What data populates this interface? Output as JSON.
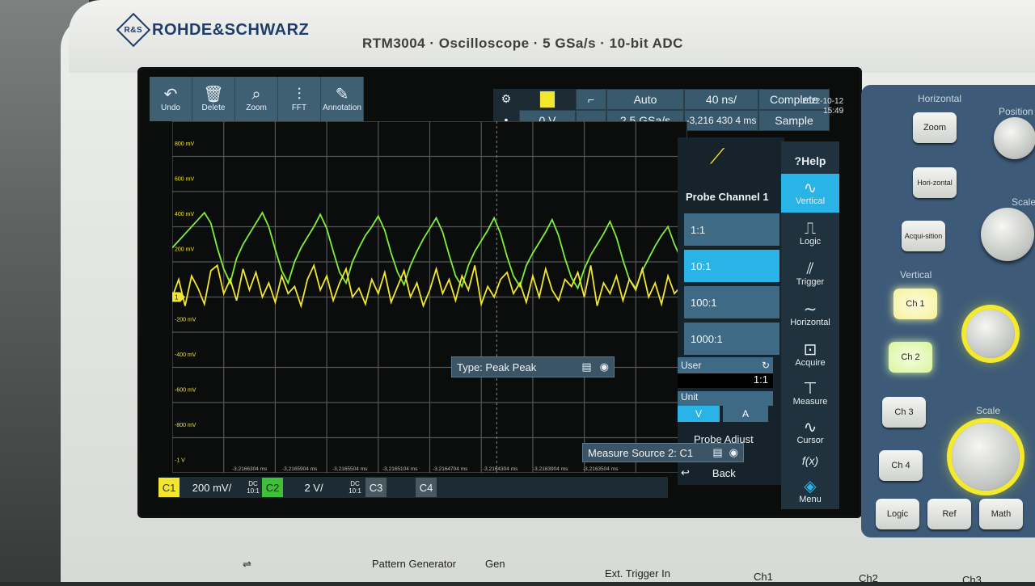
{
  "brand": {
    "name": "ROHDE&SCHWARZ",
    "model_line": "RTM3004 · Oscilloscope · 5 GSa/s · 10-bit ADC"
  },
  "toolbar": [
    {
      "label": "Undo",
      "icon": "undo-icon"
    },
    {
      "label": "Delete",
      "icon": "trash-icon"
    },
    {
      "label": "Zoom",
      "icon": "zoom-icon"
    },
    {
      "label": "FFT",
      "icon": "fft-icon"
    },
    {
      "label": "Annotation",
      "icon": "pencil-icon"
    }
  ],
  "status": {
    "trigger_level": "0 V",
    "trigger_mode": "Auto",
    "sample_rate": "2,5 GSa/s",
    "timebase": "40 ns/",
    "position": "-3,216 430 4 ms",
    "acq_state": "Complete",
    "acq_mode": "Sample",
    "date": "2022-10-12",
    "time": "15:49"
  },
  "y_labels": [
    "800 mV",
    "600 mV",
    "400 mV",
    "200 mV",
    "",
    "-200 mV",
    "-400 mV",
    "-600 mV",
    "-800 mV",
    "-1 V"
  ],
  "x_labels": [
    "-3,2166304 ms",
    "-3,2165904 ms",
    "-3,2165504 ms",
    "-3,2165104 ms",
    "-3,2164704 ms",
    "-3,2164304 ms",
    "-3,2163904 ms",
    "-3,2163504 ms"
  ],
  "marker_c1": "1",
  "probe_menu": {
    "title": "Probe Channel 1",
    "options": [
      "1:1",
      "10:1",
      "100:1",
      "1000:1"
    ],
    "selected_index": 1,
    "user_label": "User",
    "user_value": "1:1",
    "unit_label": "Unit",
    "unit_options": [
      "V",
      "A"
    ],
    "probe_adjust": "Probe Adjust",
    "back": "Back"
  },
  "right_bar": [
    {
      "label": "Help",
      "icon": "help-icon"
    },
    {
      "label": "Vertical",
      "icon": "vertical-icon"
    },
    {
      "label": "Logic",
      "icon": "logic-icon"
    },
    {
      "label": "Trigger",
      "icon": "trigger-icon"
    },
    {
      "label": "Horizontal",
      "icon": "horizontal-icon"
    },
    {
      "label": "Acquire",
      "icon": "acquire-icon"
    },
    {
      "label": "Measure",
      "icon": "measure-icon"
    },
    {
      "label": "Cursor",
      "icon": "cursor-icon"
    },
    {
      "label": "f(x)",
      "icon": "math-icon"
    },
    {
      "label": "Menu",
      "icon": "menu-icon"
    }
  ],
  "popups": {
    "type": "Type: Peak Peak",
    "measure_source": "Measure Source 2: C1"
  },
  "channel_bar": {
    "c1": "C1",
    "c1_scale": "200 mV/",
    "c1_coupling": "DC",
    "c1_probe": "10:1",
    "c2": "C2",
    "c2_scale": "2 V/",
    "c2_coupling": "DC",
    "c2_probe": "10:1",
    "c3": "C3",
    "c4": "C4"
  },
  "panel": {
    "horizontal": "Horizontal",
    "zoom": "Zoom",
    "horizontal_btn": "Hori-zontal",
    "acquisition": "Acqui-sition",
    "position": "Position",
    "scale": "Scale",
    "vertical": "Vertical",
    "ch1": "Ch 1",
    "ch2": "Ch 2",
    "ch3": "Ch 3",
    "ch4": "Ch 4",
    "logic": "Logic",
    "ref": "Ref",
    "math": "Math"
  },
  "front_labels": {
    "pattern_generator": "Pattern Generator",
    "gen": "Gen",
    "ext_trigger": "Ext. Trigger In",
    "ch1": "Ch1",
    "ch2": "Ch2",
    "ch3": "Ch3"
  },
  "colors": {
    "ch1": "#f2e62e",
    "ch2": "#7ff03a",
    "accent": "#2ab3e6",
    "button": "#3f6a85"
  },
  "chart_data": {
    "type": "line",
    "grid": true,
    "x": [
      0,
      1,
      2,
      3,
      4,
      5,
      6,
      7,
      8,
      9,
      10,
      11,
      12,
      13,
      14,
      15,
      16,
      17,
      18,
      19,
      20,
      21,
      22,
      23,
      24,
      25,
      26,
      27,
      28,
      29,
      30,
      31,
      32,
      33,
      34,
      35,
      36,
      37,
      38,
      39,
      40,
      41,
      42,
      43,
      44,
      45,
      46,
      47,
      48,
      49,
      50,
      51,
      52,
      53,
      54,
      55,
      56,
      57,
      58,
      59,
      60,
      61,
      62,
      63,
      64,
      65,
      66,
      67,
      68,
      69,
      70,
      71,
      72,
      73,
      74,
      75,
      76,
      77,
      78,
      79,
      80
    ],
    "series": [
      {
        "name": "C2",
        "values": [
          0.28,
          0.32,
          0.36,
          0.4,
          0.44,
          0.48,
          0.42,
          0.28,
          0.16,
          0.08,
          0.22,
          0.3,
          0.36,
          0.42,
          0.48,
          0.4,
          0.27,
          0.15,
          0.08,
          0.2,
          0.28,
          0.34,
          0.4,
          0.47,
          0.39,
          0.26,
          0.14,
          0.08,
          0.2,
          0.28,
          0.35,
          0.4,
          0.46,
          0.38,
          0.25,
          0.14,
          0.07,
          0.18,
          0.26,
          0.33,
          0.39,
          0.45,
          0.37,
          0.24,
          0.12,
          0.06,
          0.18,
          0.26,
          0.32,
          0.38,
          0.45,
          0.36,
          0.23,
          0.12,
          0.06,
          0.18,
          0.25,
          0.31,
          0.37,
          0.44,
          0.35,
          0.22,
          0.11,
          0.05,
          0.16,
          0.24,
          0.3,
          0.36,
          0.43,
          0.34,
          0.21,
          0.1,
          0.05,
          0.15,
          0.22,
          0.29,
          0.35,
          0.4,
          0.3,
          0.22,
          0.16
        ]
      },
      {
        "name": "C1",
        "values": [
          0.0,
          0.1,
          -0.05,
          0.12,
          0.05,
          -0.04,
          0.15,
          0.18,
          0.02,
          0.1,
          -0.02,
          0.16,
          0.04,
          0.14,
          0.0,
          0.08,
          -0.03,
          0.12,
          0.02,
          0.06,
          -0.05,
          0.1,
          0.18,
          0.04,
          0.12,
          -0.02,
          0.08,
          0.16,
          0.0,
          0.05,
          -0.04,
          0.1,
          0.02,
          0.14,
          -0.03,
          0.06,
          0.15,
          0.0,
          0.08,
          -0.05,
          0.04,
          0.16,
          0.02,
          0.1,
          -0.02,
          0.12,
          0.04,
          0.18,
          -0.04,
          0.06,
          0.0,
          0.1,
          0.14,
          0.02,
          0.08,
          -0.03,
          0.12,
          0.0,
          0.16,
          0.04,
          -0.02,
          0.1,
          0.06,
          0.14,
          0.0,
          0.18,
          -0.05,
          0.08,
          0.02,
          0.12,
          -0.02,
          0.1,
          0.04,
          0.16,
          0.0,
          0.08,
          -0.04,
          0.12,
          0.02,
          0.06,
          0.0
        ]
      }
    ],
    "ylim": [
      -1,
      1
    ]
  }
}
